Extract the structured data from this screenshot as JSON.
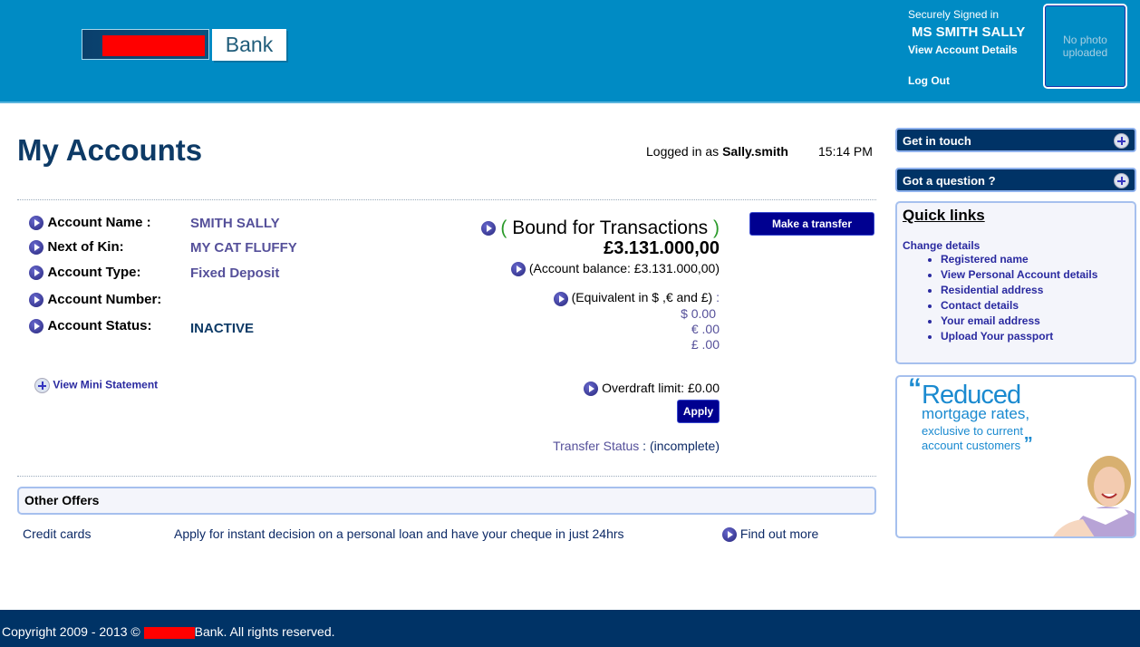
{
  "header": {
    "logo_text": "Bank",
    "signed_in_label": "Securely Signed in",
    "user_name": "MS SMITH SALLY",
    "view_account": "View Account Details",
    "logout": "Log Out",
    "photo_text": "No photo uploaded"
  },
  "main": {
    "title": "My Accounts",
    "logged_in_prefix": "Logged in as ",
    "logged_in_user": "Sally.smith",
    "time": "15:14 PM",
    "fields": [
      {
        "label": "Account Name :",
        "value": "SMITH SALLY"
      },
      {
        "label": "Next of Kin:",
        "value": "MY CAT FLUFFY"
      },
      {
        "label": "Account Type:",
        "value": "Fixed Deposit"
      },
      {
        "label": "Account Number:",
        "value": ""
      },
      {
        "label": "Account Status:",
        "value": "INACTIVE"
      }
    ],
    "mini_statement": "View Mini Statement",
    "bound_open": "(",
    "bound_label": " Bound for Transactions ",
    "bound_close": ")",
    "bound_amount": "£3.131.000,00",
    "balance": "(Account balance: £3.131.000,00)",
    "equivalent": "(Equivalent in $ ,€ and £)",
    "equivalent_colon": " :",
    "eq_usd": "$ 0.00",
    "eq_eur": "€ .00",
    "eq_gbp": "£ .00",
    "overdraft": "Overdraft limit: £0.00",
    "apply": "Apply",
    "transfer_status_label": "Transfer Status",
    "transfer_status_value": " : (incomplete)",
    "make_transfer": "Make a transfer"
  },
  "offers": {
    "title": "Other Offers",
    "items": [
      {
        "name": "Credit cards",
        "desc": "Apply for instant decision on a personal loan and have your cheque in just 24hrs",
        "link": "Find out more"
      }
    ]
  },
  "sidebar": {
    "get_in_touch": "Get in touch",
    "got_question": "Got a question ?",
    "quick_title": "Quick links",
    "change_details": "Change details",
    "links": [
      "Registered name",
      "View Personal Account details",
      "Residential address",
      "Contact details",
      "Your email address",
      "Upload Your passport"
    ],
    "ad": {
      "line1": "Reduced",
      "line2": "mortgage rates,",
      "line3": "exclusive to current",
      "line4": "account customers"
    }
  },
  "footer": {
    "prefix": "Copyright 2009 - 2013 © ",
    "suffix": "Bank. All rights reserved."
  },
  "colors": {
    "header": "#008bc4",
    "navy": "#003366",
    "button": "#000090",
    "link": "#2a2aa0"
  }
}
